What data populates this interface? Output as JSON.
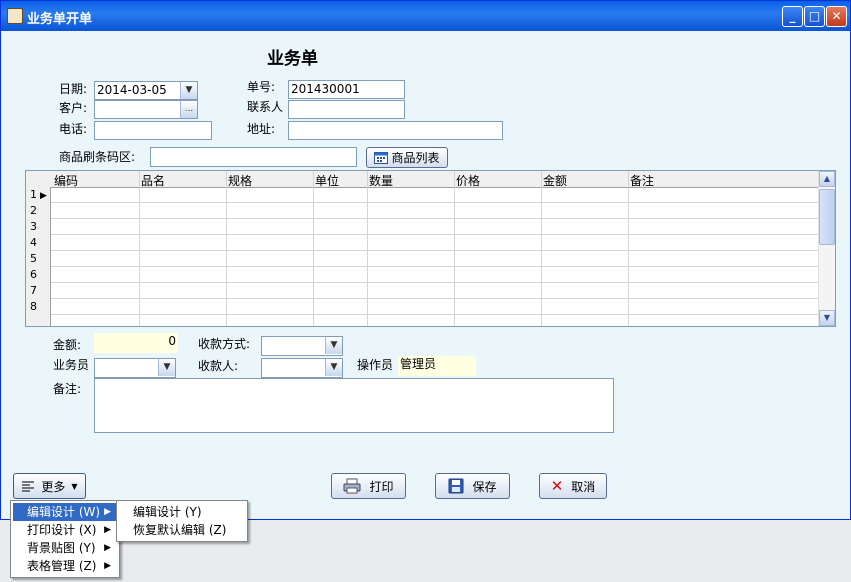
{
  "window": {
    "title": "业务单开单",
    "minimize": "_",
    "maximize": "□",
    "close": "✕"
  },
  "form": {
    "heading": "业务单",
    "date_label": "日期:",
    "date_value": "2014-03-05",
    "order_no_label": "单号:",
    "order_no_value": "201430001",
    "customer_label": "客户:",
    "customer_value": "",
    "browse_glyph": "...",
    "contact_label": "联系人",
    "contact_value": "",
    "phone_label": "电话:",
    "phone_value": "",
    "address_label": "地址:",
    "address_value": "",
    "scan_label": "商品刷条码区:",
    "scan_value": "",
    "product_list_button": "商品列表"
  },
  "grid": {
    "columns": [
      "编码",
      "品名",
      "规格",
      "单位",
      "数量",
      "价格",
      "金额",
      "备注"
    ],
    "rows": [
      "1",
      "2",
      "3",
      "4",
      "5",
      "6",
      "7",
      "8"
    ],
    "current_marker": "▶"
  },
  "summary": {
    "amount_label": "金额:",
    "amount_value": "0",
    "payment_method_label": "收款方式:",
    "payment_method_value": "",
    "salesperson_label": "业务员",
    "salesperson_value": "",
    "payee_label": "收款人:",
    "payee_value": "",
    "operator_label": "操作员",
    "operator_value": "管理员",
    "note_label": "备注:",
    "note_value": ""
  },
  "buttons": {
    "more": "更多",
    "print": "打印",
    "save": "保存",
    "cancel": "取消"
  },
  "menu": {
    "items": [
      "编辑设计 (W)",
      "打印设计 (X)",
      "背景贴图 (Y)",
      "表格管理 (Z)"
    ],
    "submenu": [
      "编辑设计 (Y)",
      "恢复默认编辑 (Z)"
    ]
  },
  "colors": {
    "title_bar": "#0a5fe8",
    "client_bg": "#eaf6fa",
    "readonly_bg": "#ffffe1",
    "menu_highlight": "#316ac5"
  }
}
